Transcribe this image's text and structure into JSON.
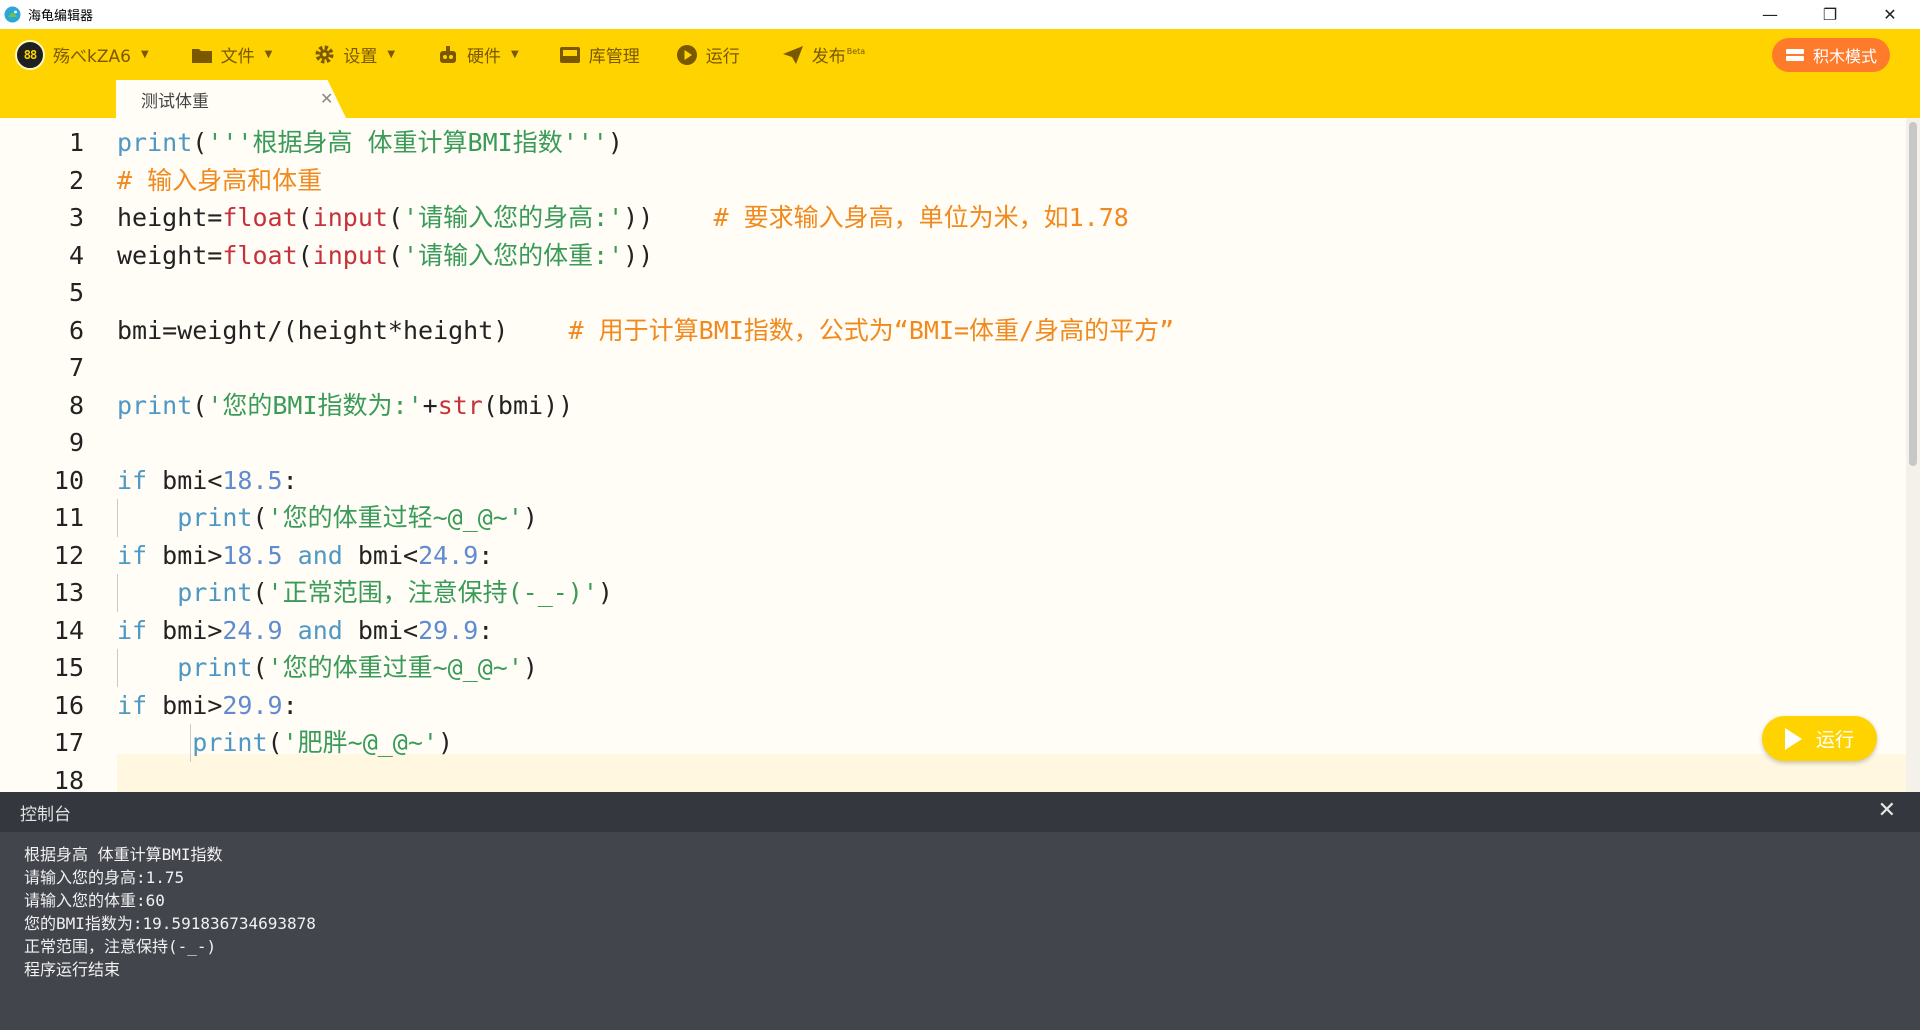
{
  "window": {
    "app_title": "海龟编辑器",
    "controls": [
      "—",
      "❐",
      "✕"
    ]
  },
  "toolbar": {
    "user_name": "殇べkZA6",
    "user_logo_text": "88",
    "file": "文件",
    "settings": "设置",
    "hardware": "硬件",
    "library": "库管理",
    "run": "运行",
    "publish": "发布",
    "publish_badge": "Beta",
    "blocks_mode": "积木模式",
    "accent_color": "#ffd300",
    "blocks_color": "#ff7b2c"
  },
  "tabs": [
    {
      "label": "测试体重",
      "close": "✕",
      "active": true
    }
  ],
  "editor": {
    "line_numbers": [
      "1",
      "2",
      "3",
      "4",
      "5",
      "6",
      "7",
      "8",
      "9",
      "10",
      "11",
      "12",
      "13",
      "14",
      "15",
      "16",
      "17",
      "18"
    ],
    "lines": [
      {
        "tokens": [
          {
            "t": "print",
            "c": "blue"
          },
          {
            "t": "(",
            "c": "plain"
          },
          {
            "t": "'''根据身高 体重计算BMI指数'''",
            "c": "str"
          },
          {
            "t": ")",
            "c": "plain"
          }
        ]
      },
      {
        "tokens": [
          {
            "t": "# 输入身高和体重",
            "c": "cmt"
          }
        ]
      },
      {
        "tokens": [
          {
            "t": "height=",
            "c": "plain"
          },
          {
            "t": "float",
            "c": "red"
          },
          {
            "t": "(",
            "c": "plain"
          },
          {
            "t": "input",
            "c": "red"
          },
          {
            "t": "(",
            "c": "plain"
          },
          {
            "t": "'请输入您的身高:'",
            "c": "str"
          },
          {
            "t": "))    ",
            "c": "plain"
          },
          {
            "t": "# 要求输入身高，单位为米，如1.78",
            "c": "cmt"
          }
        ]
      },
      {
        "tokens": [
          {
            "t": "weight=",
            "c": "plain"
          },
          {
            "t": "float",
            "c": "red"
          },
          {
            "t": "(",
            "c": "plain"
          },
          {
            "t": "input",
            "c": "red"
          },
          {
            "t": "(",
            "c": "plain"
          },
          {
            "t": "'请输入您的体重:'",
            "c": "str"
          },
          {
            "t": "))",
            "c": "plain"
          }
        ]
      },
      {
        "tokens": []
      },
      {
        "tokens": [
          {
            "t": "bmi=weight/(height*height)    ",
            "c": "plain"
          },
          {
            "t": "# 用于计算BMI指数，公式为“BMI=体重/身高的平方”",
            "c": "cmt"
          }
        ]
      },
      {
        "tokens": []
      },
      {
        "tokens": [
          {
            "t": "print",
            "c": "blue"
          },
          {
            "t": "(",
            "c": "plain"
          },
          {
            "t": "'您的BMI指数为:'",
            "c": "str"
          },
          {
            "t": "+",
            "c": "plain"
          },
          {
            "t": "str",
            "c": "red"
          },
          {
            "t": "(bmi))",
            "c": "plain"
          }
        ]
      },
      {
        "tokens": []
      },
      {
        "tokens": [
          {
            "t": "if",
            "c": "blue"
          },
          {
            "t": " bmi<",
            "c": "plain"
          },
          {
            "t": "18.5",
            "c": "num"
          },
          {
            "t": ":",
            "c": "plain"
          }
        ]
      },
      {
        "tokens": [
          {
            "t": "    ",
            "c": "plain"
          },
          {
            "t": "print",
            "c": "blue"
          },
          {
            "t": "(",
            "c": "plain"
          },
          {
            "t": "'您的体重过轻~@_@~'",
            "c": "str"
          },
          {
            "t": ")",
            "c": "plain"
          }
        ],
        "guide": 1
      },
      {
        "tokens": [
          {
            "t": "if",
            "c": "blue"
          },
          {
            "t": " bmi>",
            "c": "plain"
          },
          {
            "t": "18.5",
            "c": "num"
          },
          {
            "t": " ",
            "c": "plain"
          },
          {
            "t": "and",
            "c": "blue"
          },
          {
            "t": " bmi<",
            "c": "plain"
          },
          {
            "t": "24.9",
            "c": "num"
          },
          {
            "t": ":",
            "c": "plain"
          }
        ]
      },
      {
        "tokens": [
          {
            "t": "    ",
            "c": "plain"
          },
          {
            "t": "print",
            "c": "blue"
          },
          {
            "t": "(",
            "c": "plain"
          },
          {
            "t": "'正常范围，注意保持(-_-)'",
            "c": "str"
          },
          {
            "t": ")",
            "c": "plain"
          }
        ],
        "guide": 1
      },
      {
        "tokens": [
          {
            "t": "if",
            "c": "blue"
          },
          {
            "t": " bmi>",
            "c": "plain"
          },
          {
            "t": "24.9",
            "c": "num"
          },
          {
            "t": " ",
            "c": "plain"
          },
          {
            "t": "and",
            "c": "blue"
          },
          {
            "t": " bmi<",
            "c": "plain"
          },
          {
            "t": "29.9",
            "c": "num"
          },
          {
            "t": ":",
            "c": "plain"
          }
        ]
      },
      {
        "tokens": [
          {
            "t": "    ",
            "c": "plain"
          },
          {
            "t": "print",
            "c": "blue"
          },
          {
            "t": "(",
            "c": "plain"
          },
          {
            "t": "'您的体重过重~@_@~'",
            "c": "str"
          },
          {
            "t": ")",
            "c": "plain"
          }
        ],
        "guide": 1
      },
      {
        "tokens": [
          {
            "t": "if",
            "c": "blue"
          },
          {
            "t": " bmi>",
            "c": "plain"
          },
          {
            "t": "29.9",
            "c": "num"
          },
          {
            "t": ":",
            "c": "plain"
          }
        ]
      },
      {
        "tokens": [
          {
            "t": "     ",
            "c": "plain"
          },
          {
            "t": "print",
            "c": "blue"
          },
          {
            "t": "(",
            "c": "plain"
          },
          {
            "t": "'肥胖~@_@~'",
            "c": "str"
          },
          {
            "t": ")",
            "c": "plain"
          }
        ],
        "guide": 2
      },
      {
        "tokens": []
      }
    ],
    "current_line": 18,
    "run_button": "运行"
  },
  "console": {
    "title": "控制台",
    "close": "✕",
    "lines": [
      "根据身高 体重计算BMI指数",
      "请输入您的身高:1.75",
      "请输入您的体重:60",
      "您的BMI指数为:19.591836734693878",
      "正常范围，注意保持(-_-)",
      "程序运行结束"
    ]
  }
}
